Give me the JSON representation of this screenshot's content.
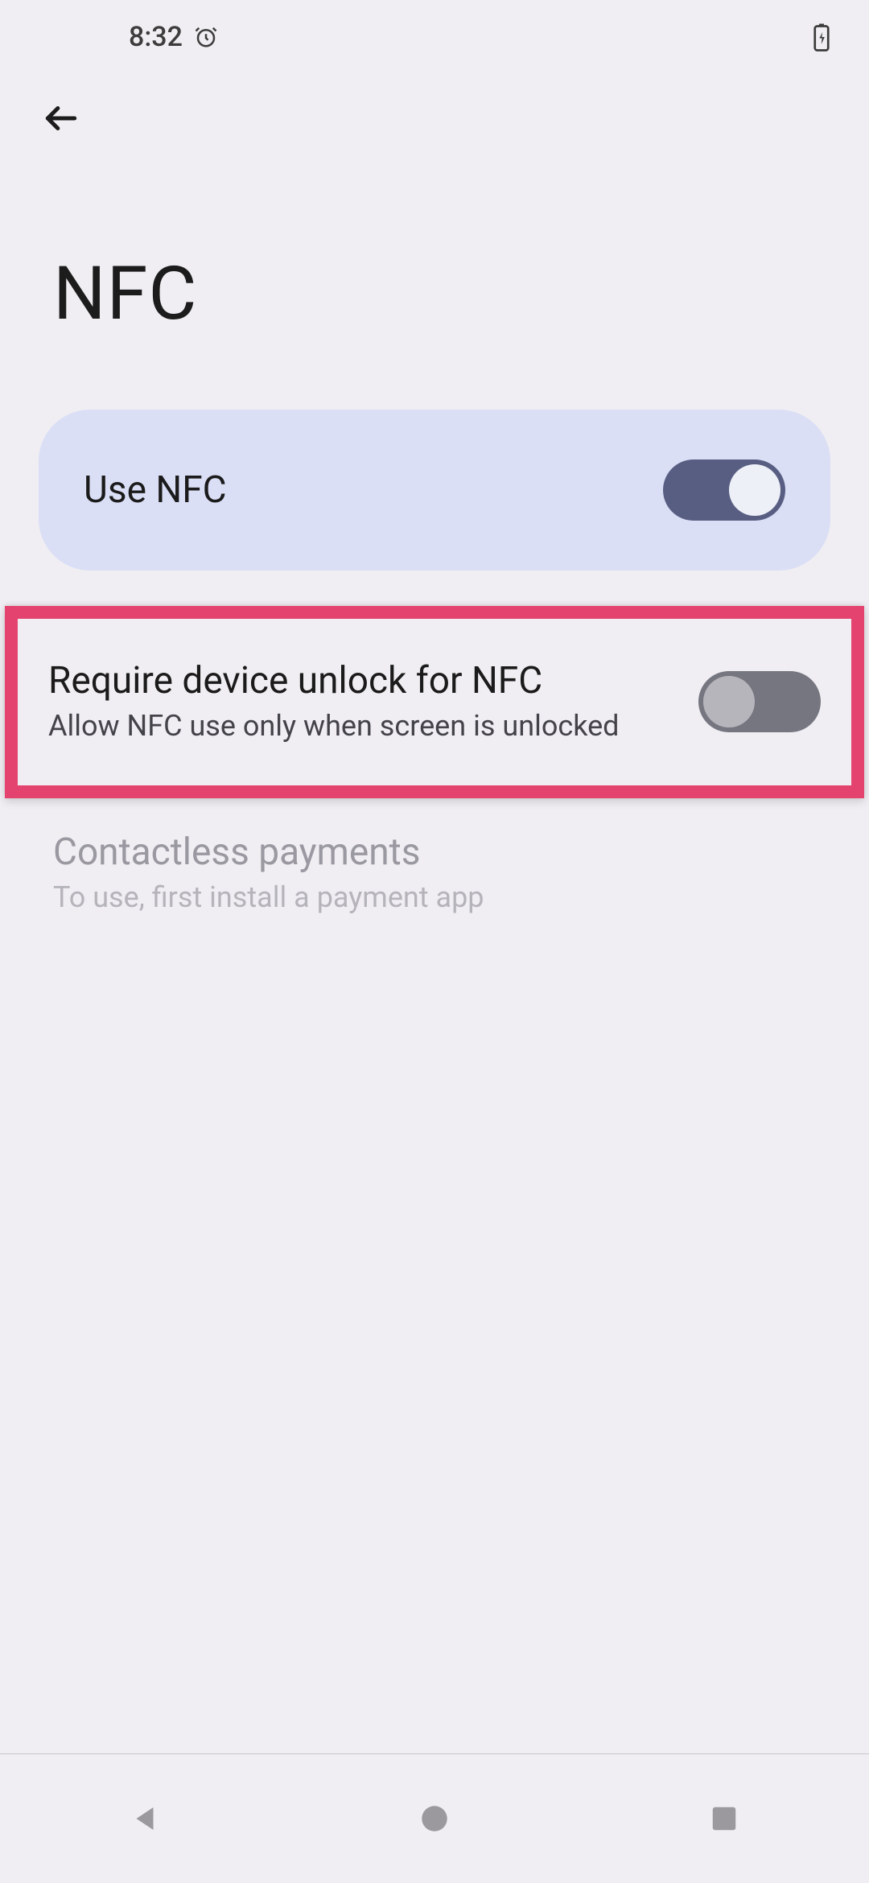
{
  "status": {
    "time": "8:32",
    "icons": {
      "alarm": "alarm-icon",
      "battery": "battery-charging-icon"
    }
  },
  "header": {
    "back": "back-icon",
    "title": "NFC"
  },
  "settings": {
    "toggle_card": {
      "label": "Use NFC",
      "state": "on"
    },
    "require_unlock": {
      "title": "Require device unlock for NFC",
      "subtitle": "Allow NFC use only when screen is unlocked",
      "state": "off",
      "highlighted": true
    },
    "contactless": {
      "title": "Contactless payments",
      "subtitle": "To use, first install a payment app",
      "enabled": false
    }
  },
  "navbar": {
    "back": "nav-back-icon",
    "home": "nav-home-icon",
    "recents": "nav-recents-icon"
  },
  "colors": {
    "background": "#f0eef2",
    "card": "#dadff6",
    "switch_on": "#585e82",
    "highlight": "#e3436e",
    "text_primary": "#1b1b1b",
    "text_secondary": "#44434a",
    "text_disabled": "#9a98a0"
  }
}
